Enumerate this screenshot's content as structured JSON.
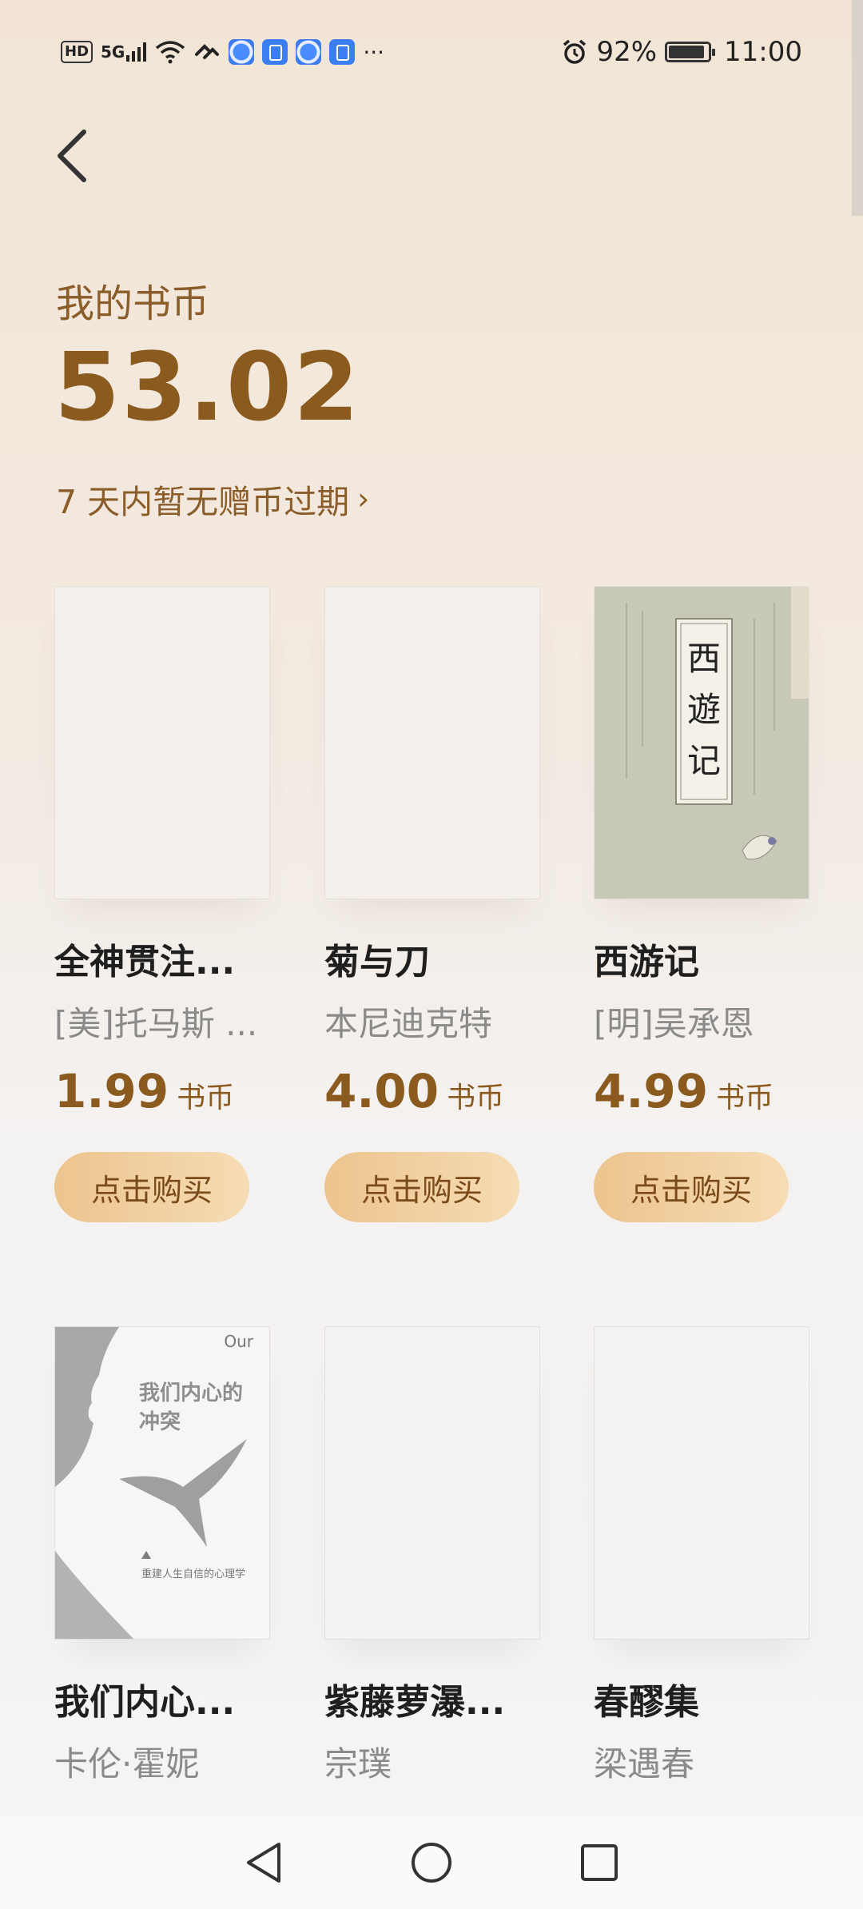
{
  "status_bar": {
    "hd": "HD",
    "signal": "5G",
    "left_icons": [
      "hd-icon",
      "signal-5g-icon",
      "wifi-icon",
      "link-icon",
      "browser-app-icon",
      "qq-app-icon",
      "browser-app-icon",
      "qq-app-icon",
      "more-notifications-icon"
    ],
    "more": "···",
    "alarm_icon": "alarm-clock-icon",
    "battery": "92%",
    "battery_level": 0.92,
    "time": "11:00"
  },
  "header": {
    "back_icon": "chevron-left-icon"
  },
  "coins": {
    "label": "我的书币",
    "value": "53.02",
    "expire_text": "7 天内暂无赠币过期",
    "expire_arrow": "›"
  },
  "books": [
    {
      "title": "全神贯注...",
      "author": "[美]托马斯 ...",
      "price": "1.99",
      "unit": "书币",
      "buy": "点击购买"
    },
    {
      "title": "菊与刀",
      "author": "本尼迪克特",
      "price": "4.00",
      "unit": "书币",
      "buy": "点击购买"
    },
    {
      "title": "西游记",
      "author": "[明]吴承恩",
      "price": "4.99",
      "unit": "书币",
      "buy": "点击购买",
      "cover_text": "西遊记"
    },
    {
      "title": "我们内心...",
      "author": "卡伦·霍妮",
      "cover_brand": "Our",
      "cover_title_1": "我们内心的",
      "cover_title_2": "冲突",
      "cover_tagline": "重建人生自信的心理学"
    },
    {
      "title": "紫藤萝瀑...",
      "author": "宗璞"
    },
    {
      "title": "春醪集",
      "author": "梁遇春"
    }
  ],
  "nav": {
    "back_icon": "triangle-back-icon",
    "home_icon": "circle-home-icon",
    "recents_icon": "square-recents-icon"
  }
}
